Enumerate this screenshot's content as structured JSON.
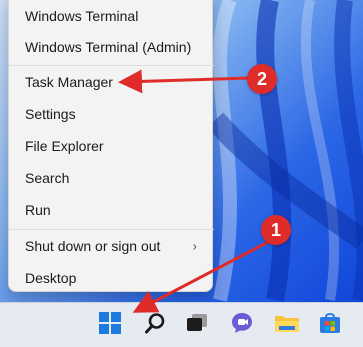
{
  "context_menu": {
    "items": [
      {
        "label": "Windows Terminal"
      },
      {
        "label": "Windows Terminal (Admin)"
      },
      {
        "label": "Task Manager"
      },
      {
        "label": "Settings"
      },
      {
        "label": "File Explorer"
      },
      {
        "label": "Search"
      },
      {
        "label": "Run"
      },
      {
        "label": "Shut down or sign out",
        "submenu_glyph": "›"
      },
      {
        "label": "Desktop"
      }
    ]
  },
  "taskbar": {
    "icons": [
      "windows-start-icon",
      "search-icon",
      "task-view-icon",
      "teams-chat-icon",
      "file-explorer-icon",
      "microsoft-store-icon"
    ]
  },
  "annotations": [
    {
      "number": "1",
      "color": "#e02b2b"
    },
    {
      "number": "2",
      "color": "#e02b2b"
    }
  ]
}
